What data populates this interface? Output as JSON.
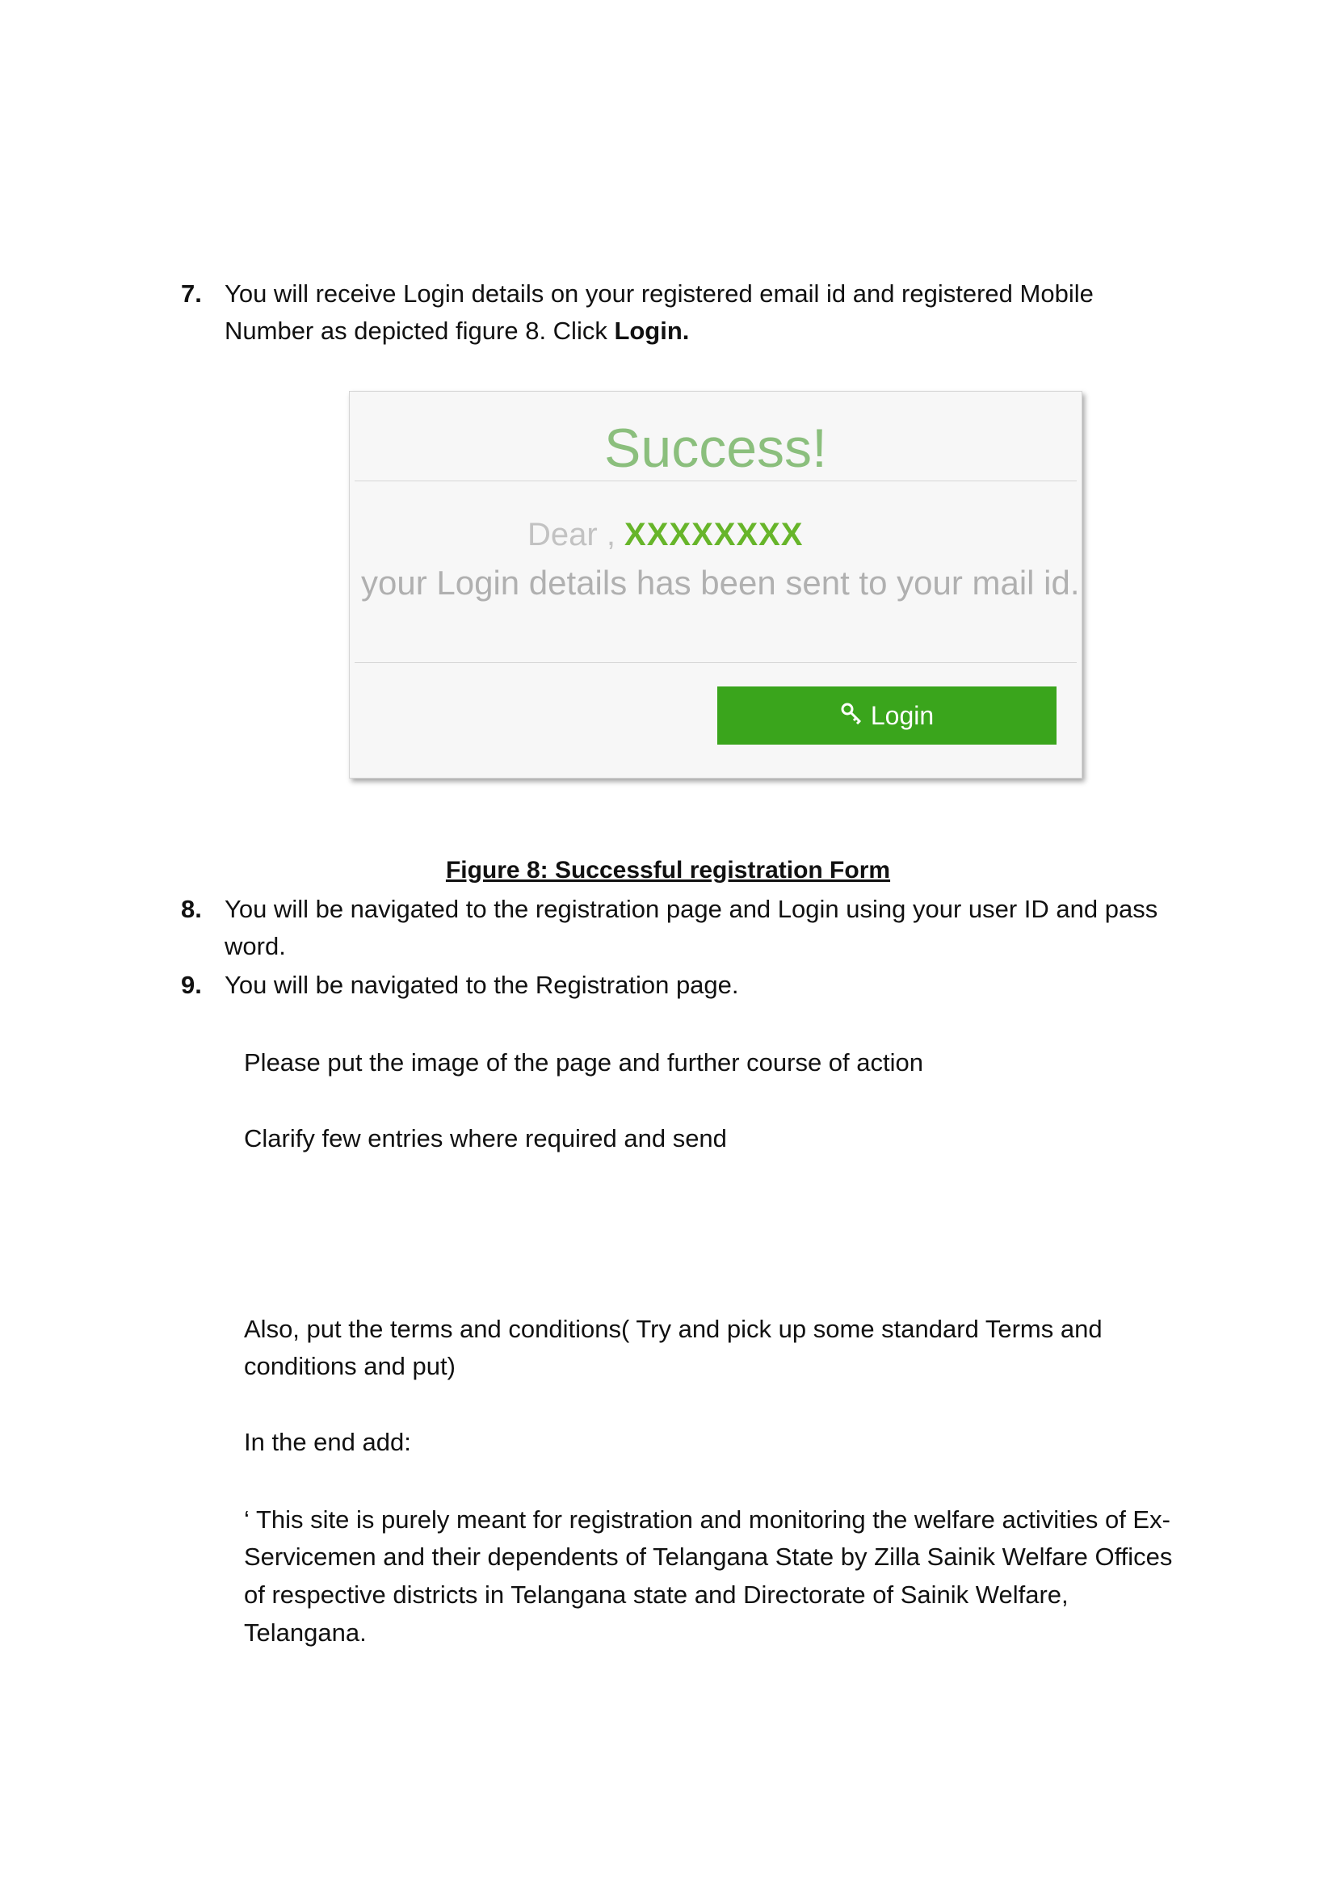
{
  "step7": {
    "number": "7.",
    "line1": "You will receive  Login details on your  registered email id and registered Mobile",
    "line2_prefix": "Number as depicted figure 8.  Click ",
    "line2_bold": "Login."
  },
  "screenshot": {
    "title": "Success!",
    "dear": "Dear , ",
    "name": "XXXXXXXX",
    "message": "your Login details has been sent to your mail id.",
    "login_icon": "key-icon",
    "login_label": "Login",
    "colors": {
      "button": "#3aa51c",
      "name": "#67b52a",
      "title": "#8bbf7d"
    }
  },
  "figure_caption": "Figure 8: Successful registration Form",
  "step8": {
    "number": "8.",
    "line1": "You will be navigated to the registration page and Login using your user ID and pass",
    "line2": "word."
  },
  "step9": {
    "number": "9.",
    "line1": "You will be navigated to the Registration page."
  },
  "notes": {
    "image_note": "Please put the image of the page and further course of action",
    "clarify_note": "Clarify few entries where required and send",
    "terms_line1": "Also, put the terms and conditions(  Try and pick up some standard Terms and",
    "terms_line2": "conditions and put)",
    "end_label": "In the end add:",
    "disclaimer_line1": "‘ This site is purely meant for registration and monitoring the welfare activities of Ex-",
    "disclaimer_line2": "Servicemen  and their dependents of Telangana State by Zilla Sainik Welfare Offices",
    "disclaimer_line3": "of respective districts in Telangana state and Directorate of Sainik Welfare,",
    "disclaimer_line4": "Telangana."
  }
}
